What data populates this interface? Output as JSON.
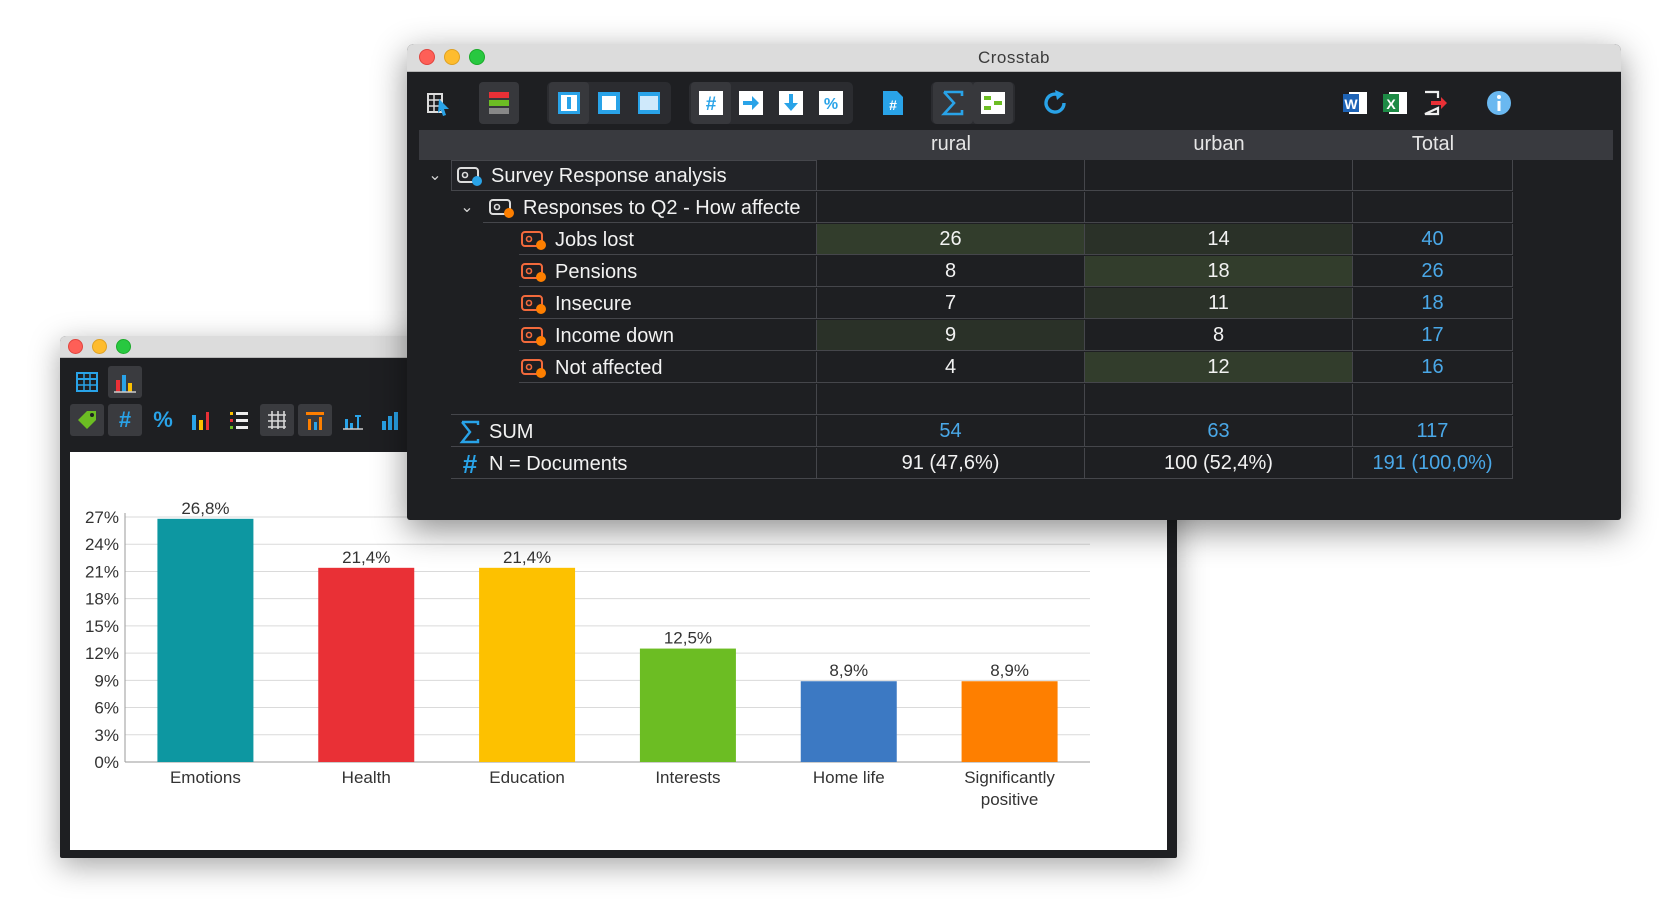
{
  "crosstab": {
    "window_title": "Crosstab",
    "columns": [
      "rural",
      "urban",
      "Total"
    ],
    "tree": {
      "root_label": "Survey Response analysis",
      "sub_label": "Responses to Q2 - How affecte"
    },
    "rows": [
      {
        "label": "Jobs lost",
        "rural": "26",
        "urban": "14",
        "total": "40"
      },
      {
        "label": "Pensions",
        "rural": "8",
        "urban": "18",
        "total": "26"
      },
      {
        "label": "Insecure",
        "rural": "7",
        "urban": "11",
        "total": "18"
      },
      {
        "label": "Income down",
        "rural": "9",
        "urban": "8",
        "total": "17"
      },
      {
        "label": "Not affected",
        "rural": "4",
        "urban": "12",
        "total": "16"
      }
    ],
    "sum": {
      "label": "SUM",
      "rural": "54",
      "urban": "63",
      "total": "117"
    },
    "ndocs": {
      "label": "N = Documents",
      "rural": "91 (47,6%)",
      "urban": "100 (52,4%)",
      "total": "191 (100,0%)"
    },
    "colors": {
      "accent": "#4aa8e8",
      "code_icon": "#f26a3c",
      "highlight": "#323d2c"
    }
  },
  "chart_window": {
    "toolbar_row1": [
      "table-icon",
      "bar-chart-icon"
    ],
    "toolbar_row2": [
      "tag-icon",
      "hash-icon",
      "percent-icon",
      "stacked-bars-icon",
      "list-icon",
      "grid-icon",
      "bar-labels-icon",
      "bar-axis-icon",
      "bar-chart-icon"
    ]
  },
  "chart_data": {
    "type": "bar",
    "categories": [
      "Emotions",
      "Health",
      "Education",
      "Interests",
      "Home life",
      "Significantly positive"
    ],
    "category_lines": [
      [
        "Emotions"
      ],
      [
        "Health"
      ],
      [
        "Education"
      ],
      [
        "Interests"
      ],
      [
        "Home life"
      ],
      [
        "Significantly",
        "positive"
      ]
    ],
    "values": [
      26.8,
      21.4,
      21.4,
      12.5,
      8.9,
      8.9
    ],
    "value_labels": [
      "26,8%",
      "21,4%",
      "21,4%",
      "12,5%",
      "8,9%",
      "8,9%"
    ],
    "colors": [
      "#0d97a1",
      "#e93036",
      "#fdc100",
      "#6cbd23",
      "#3c79c3",
      "#fe7f00"
    ],
    "yticks": [
      "0%",
      "3%",
      "6%",
      "9%",
      "12%",
      "15%",
      "18%",
      "21%",
      "24%",
      "27%"
    ],
    "ylim": [
      0,
      27
    ],
    "title": "",
    "xlabel": "",
    "ylabel": "",
    "grid": true
  }
}
